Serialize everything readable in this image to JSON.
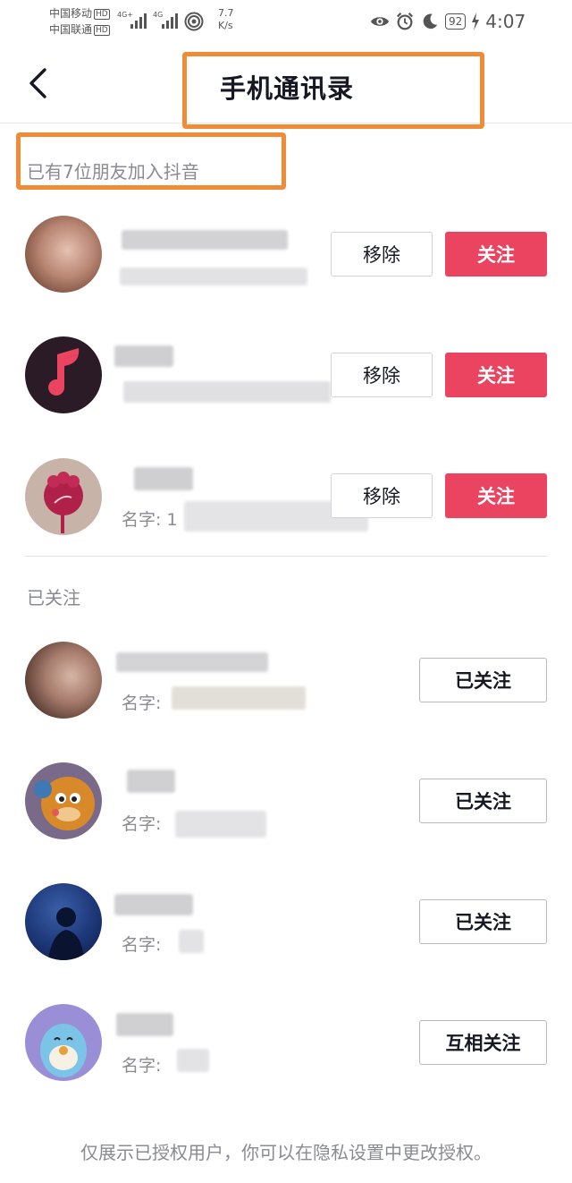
{
  "status_bar": {
    "carrier1": "中国移动",
    "carrier2": "中国联通",
    "hd": "HD",
    "net1": "4G+",
    "net2": "4G",
    "speed_value": "7.7",
    "speed_unit": "K/s",
    "battery": "92",
    "time": "4:07"
  },
  "header": {
    "title": "手机通讯录"
  },
  "highlight_color": "#F08C38",
  "friends_section": {
    "count_label": "已有7位朋友加入抖音",
    "rows": [
      {
        "remove_label": "移除",
        "follow_label": "关注"
      },
      {
        "remove_label": "移除",
        "follow_label": "关注"
      },
      {
        "name_prefix": "名字: 1",
        "remove_label": "移除",
        "follow_label": "关注"
      }
    ]
  },
  "followed_section": {
    "label": "已关注",
    "rows": [
      {
        "name_prefix": "名字:",
        "button_label": "已关注"
      },
      {
        "name_prefix": "名字:",
        "button_label": "已关注"
      },
      {
        "name_prefix": "名字:",
        "button_label": "已关注"
      },
      {
        "name_prefix": "名字:",
        "button_label": "互相关注"
      }
    ]
  },
  "footer": {
    "note": "仅展示已授权用户，你可以在隐私设置中更改授权。"
  },
  "colors": {
    "follow_button": "#EA4461",
    "secondary_text": "#8a8b91"
  }
}
